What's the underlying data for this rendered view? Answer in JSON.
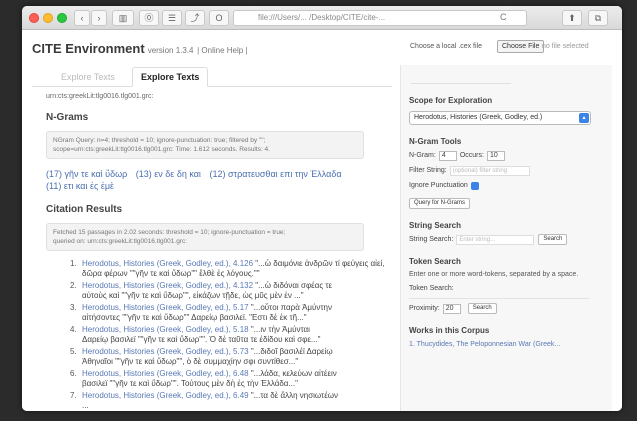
{
  "browser": {
    "address": "file:///Users/... /Desktop/CITE/cite-...",
    "reload_glyph": "C",
    "buttons": [
      "‹",
      "›",
      "▥",
      "⓪",
      "☰",
      "⤴",
      "O",
      "⬆",
      "⧉"
    ]
  },
  "header": {
    "title": "CITE Environment",
    "version": "version 1.3.4",
    "help": "| Online Help |",
    "local_label": "Choose a local .cex file",
    "choose_file": "Choose File",
    "no_file": "no file selected"
  },
  "tabs": [
    {
      "label": "Explore Texts",
      "active": false
    },
    {
      "label": "Explore Texts",
      "active": true
    }
  ],
  "urn_line": "urn:cts:greekLit:tlg0016.tlg001.grc:",
  "ngrams": {
    "heading": "N-Grams",
    "status": [
      "NGram Query: n=4; threshold = 10; ignore-punctuation: true; filtered by \"\";",
      "scope=urn:cts:greekLit:tlg0016.tlg001.grc: Time: 1.612 seconds. Results: 4."
    ],
    "results": [
      "(17) γῆν τε καὶ ὕδωρ",
      "(13) εν δε δη και",
      "(12) στρατευσθαι επι την Ἑλλαδα",
      "(11) ετι και ἐς ἐμὲ"
    ]
  },
  "citations": {
    "heading": "Citation Results",
    "status": [
      "Fetched 15 passages in 2.02 seconds: threshold = 10; ignore-punctuation = true;",
      "queried on: urn:cts:greekLit:tlg0016.tlg001.grc:"
    ],
    "items": [
      {
        "num": "1.",
        "link": "Herodotus, Histories (Greek, Godley, ed.), 4.126",
        "text": " \"...ὦ δαιμόνιε ἀνδρῶν τί φεύγεις αἰεί,",
        "text2": "δῶρα φέρων \"\"γῆν τε καὶ ὕδωρ\"\" ἔλθὲ ἐς λόγους.\"\""
      },
      {
        "num": "2.",
        "link": "Herodotus, Histories (Greek, Godley, ed.), 4.132",
        "text": " \"...ὦ διδόναι σφέας τε",
        "text2": "αὐτοὺς καὶ \"\"γῆν τε καὶ ὕδωρ\"\", εἰκάζων τῇδε, ὡς μῦς μὲν ἐν ...\""
      },
      {
        "num": "3.",
        "link": "Herodotus, Histories (Greek, Godley, ed.), 5.17",
        "text": " \"...οὗτοι παρὰ Ἀμύντην",
        "text2": "αἰτήσοντες \"\"γῆν τε καὶ ὕδωρ\"\" Δαρείῳ βασιλεϊ. \"Εστι δὲ ἐκ τῆ...\""
      },
      {
        "num": "4.",
        "link": "Herodotus, Histories (Greek, Godley, ed.), 5.18",
        "text": " \"...ιν τὴν Ἀμύνται",
        "text2": "Δαρείῳ βασιλεϊ \"\"γῆν τε καὶ ὕδωρ\"\". Ὁ δὲ ταῦτα τε ἐδίδου καὶ σφε...\""
      },
      {
        "num": "5.",
        "link": "Herodotus, Histories (Greek, Godley, ed.), 5.73",
        "text": " \"...διδοῖ βασιλέϊ Δαρείῳ",
        "text2": "Ἀθηναῖοι \"\"γῆν τε καὶ ὕδωρ\"\", ὁ δὲ συμμαχίην σφι συντίθεσ...\""
      },
      {
        "num": "6.",
        "link": "Herodotus, Histories (Greek, Godley, ed.), 6.48",
        "text": " \"...λάδα, κελεύων αἰτέειν",
        "text2": "βασιλεϊ \"\"γῆν τε καὶ ὕδωρ\"\". Τούτους μὲν δὴ ἐς τὴν Ἑλλάδα...\""
      },
      {
        "num": "7.",
        "link": "Herodotus, Histories (Greek, Godley, ed.), 6.49",
        "text": " \"...τα δὲ ἄλλη νησιωτέων",
        "text2": "..."
      }
    ]
  },
  "sidebar": {
    "scope_heading": "Scope for Exploration",
    "scope_value": "Herodotus, Histories (Greek, Godley, ed.)",
    "ngram_tools": {
      "heading": "N-Gram Tools",
      "ngram_label": "N-Gram:",
      "ngram_value": "4",
      "occurs_label": "Occurs:",
      "occurs_value": "10",
      "filter_label": "Filter String:",
      "filter_placeholder": "(optional) filter string",
      "ignore_label": "Ignore Punctuation",
      "query_button": "Query for N-Grams"
    },
    "string_search": {
      "heading": "String Search",
      "label": "String Search:",
      "placeholder": "Enter string...",
      "button": "Search"
    },
    "token_search": {
      "heading": "Token Search",
      "description": "Enter one or more word-tokens, separated by a space.",
      "label": "Token Search:",
      "proximity_label": "Proximity:",
      "proximity_value": "20",
      "button": "Search"
    },
    "works": {
      "heading": "Works in this Corpus",
      "first": "1. Thucydides, The Peloponnesian War (Greek..."
    }
  }
}
